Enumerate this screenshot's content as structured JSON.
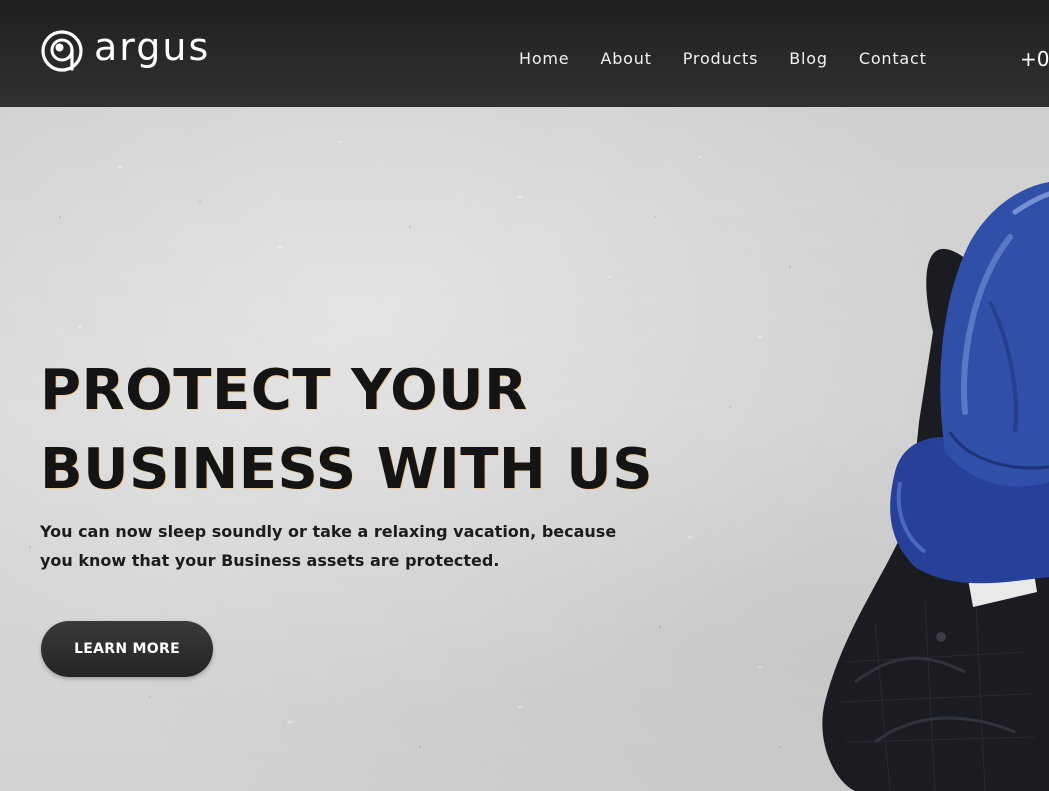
{
  "brand": {
    "name": "argus",
    "logo_icon": "eye-at-logo-icon"
  },
  "nav": {
    "items": [
      {
        "label": "Home"
      },
      {
        "label": "About"
      },
      {
        "label": "Products"
      },
      {
        "label": "Blog"
      },
      {
        "label": "Contact"
      }
    ]
  },
  "header": {
    "phone_partial": "+0"
  },
  "hero": {
    "headline_line1": "PROTECT YOUR",
    "headline_line2": "BUSINESS WITH US",
    "subtext": "You can now sleep soundly or take a relaxing vacation, because you know that your Business assets are protected.",
    "cta_label": "LEARN MORE",
    "image": "businessman-with-blue-boxing-gloves"
  },
  "colors": {
    "header_bg": "#2a2a2a",
    "hero_bg": "#d4d4d4",
    "text_dark": "#141414",
    "glove_blue": "#2f4fa8",
    "button_bg": "#2b2b2b"
  }
}
